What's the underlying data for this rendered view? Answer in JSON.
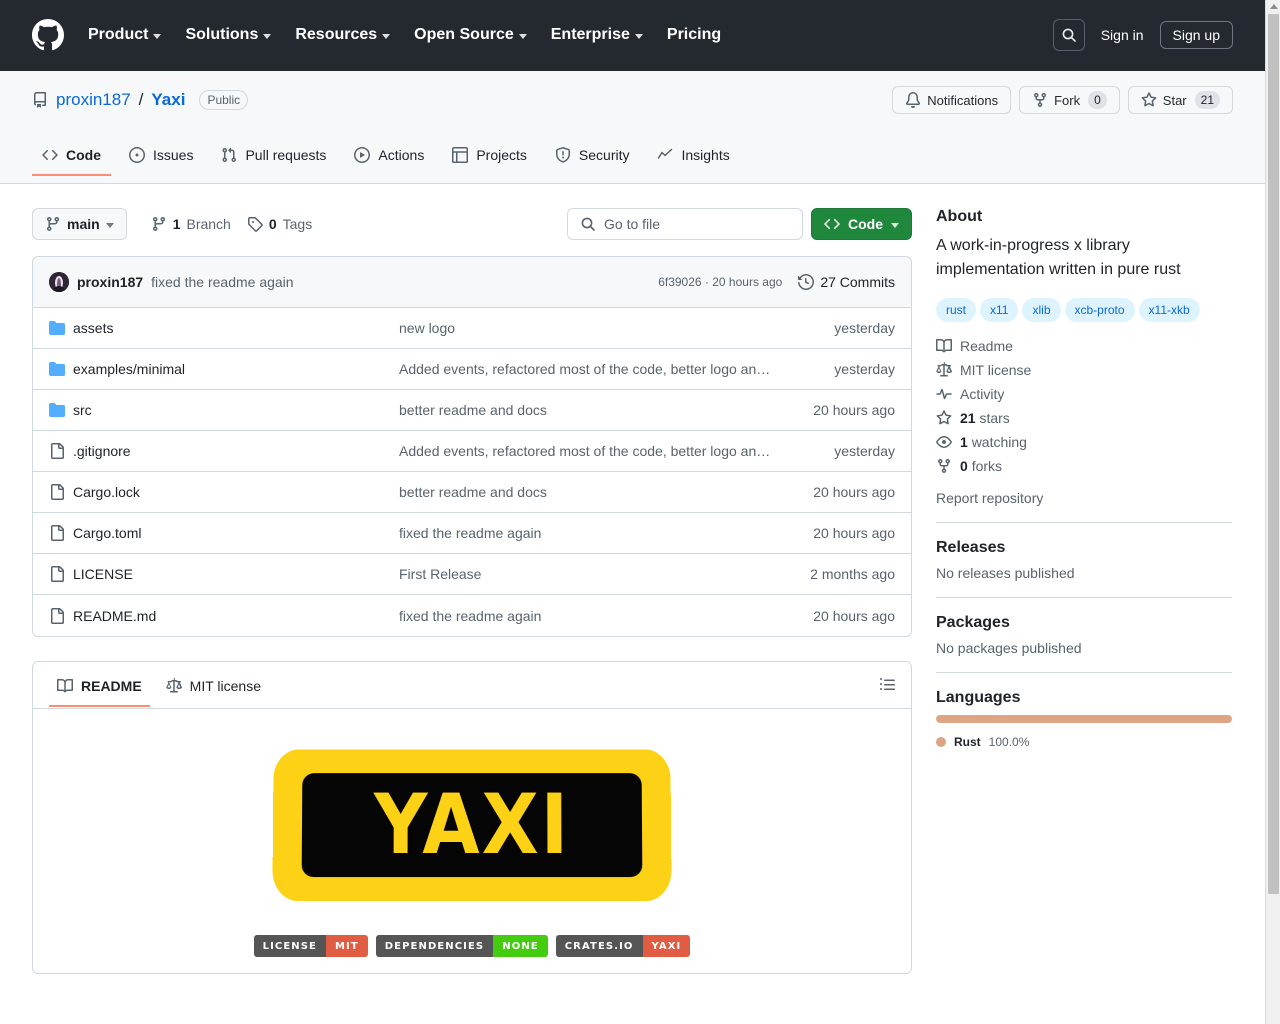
{
  "header": {
    "logo_icon": "github-mark-icon",
    "nav": [
      {
        "label": "Product",
        "has_caret": true
      },
      {
        "label": "Solutions",
        "has_caret": true
      },
      {
        "label": "Resources",
        "has_caret": true
      },
      {
        "label": "Open Source",
        "has_caret": true
      },
      {
        "label": "Enterprise",
        "has_caret": true
      },
      {
        "label": "Pricing",
        "has_caret": false
      }
    ],
    "search_icon": "search-icon",
    "sign_in": "Sign in",
    "sign_up": "Sign up"
  },
  "repo": {
    "repo_icon": "repo-icon",
    "owner": "proxin187",
    "separator": "/",
    "name": "Yaxi",
    "visibility": "Public",
    "actions": {
      "notifications": "Notifications",
      "fork_label": "Fork",
      "fork_count": "0",
      "star_label": "Star",
      "star_count": "21"
    },
    "tabs": [
      {
        "label": "Code",
        "icon": "code-icon",
        "active": true
      },
      {
        "label": "Issues",
        "icon": "issue-opened-icon",
        "active": false
      },
      {
        "label": "Pull requests",
        "icon": "git-pull-request-icon",
        "active": false
      },
      {
        "label": "Actions",
        "icon": "play-icon",
        "active": false
      },
      {
        "label": "Projects",
        "icon": "table-icon",
        "active": false
      },
      {
        "label": "Security",
        "icon": "shield-icon",
        "active": false
      },
      {
        "label": "Insights",
        "icon": "graph-icon",
        "active": false
      }
    ]
  },
  "toolbar": {
    "branch_name": "main",
    "branch_icon": "git-branch-icon",
    "branch_count": "1",
    "branch_word": "Branch",
    "tag_icon": "tag-icon",
    "tag_count": "0",
    "tag_word": "Tags",
    "search_placeholder": "Go to file",
    "code_button": "Code"
  },
  "commit_bar": {
    "avatar_name": "avatar",
    "author": "proxin187",
    "message": "fixed the readme again",
    "sha_and_time": "6f39026 · 20 hours ago",
    "commits_icon": "history-icon",
    "commits_label": "27 Commits"
  },
  "files": [
    {
      "type": "dir",
      "name": "assets",
      "message": "new logo",
      "age": "yesterday"
    },
    {
      "type": "dir",
      "name": "examples/minimal",
      "message": "Added events, refactored most of the code, better logo an…",
      "age": "yesterday"
    },
    {
      "type": "dir",
      "name": "src",
      "message": "better readme and docs",
      "age": "20 hours ago"
    },
    {
      "type": "file",
      "name": ".gitignore",
      "message": "Added events, refactored most of the code, better logo an…",
      "age": "yesterday"
    },
    {
      "type": "file",
      "name": "Cargo.lock",
      "message": "better readme and docs",
      "age": "20 hours ago"
    },
    {
      "type": "file",
      "name": "Cargo.toml",
      "message": "fixed the readme again",
      "age": "20 hours ago"
    },
    {
      "type": "file",
      "name": "LICENSE",
      "message": "First Release",
      "age": "2 months ago"
    },
    {
      "type": "file",
      "name": "README.md",
      "message": "fixed the readme again",
      "age": "20 hours ago"
    }
  ],
  "readme": {
    "tabs": [
      {
        "label": "README",
        "icon": "book-icon",
        "active": true
      },
      {
        "label": "MIT license",
        "icon": "law-icon",
        "active": false
      }
    ],
    "outline_icon": "list-unordered-icon",
    "logo_text": "YAXI",
    "logo_bg_color": "#FCD116",
    "logo_panel_color": "#050505",
    "badges": [
      {
        "key": "LICENSE",
        "value": "MIT",
        "value_color": "#e05d44"
      },
      {
        "key": "DEPENDENCIES",
        "value": "NONE",
        "value_color": "#44cc11"
      },
      {
        "key": "CRATES.IO",
        "value": "YAXI",
        "value_color": "#e05d44"
      }
    ]
  },
  "sidebar": {
    "about_title": "About",
    "description": "A work-in-progress x library implementation written in pure rust",
    "topics": [
      "rust",
      "x11",
      "xlib",
      "xcb-proto",
      "x11-xkb"
    ],
    "links": [
      {
        "icon": "book-icon",
        "label": "Readme",
        "strong": "",
        "rest": "Readme"
      },
      {
        "icon": "law-icon",
        "label": "MIT license",
        "strong": "",
        "rest": "MIT license"
      },
      {
        "icon": "pulse-icon",
        "label": "Activity",
        "strong": "",
        "rest": "Activity"
      },
      {
        "icon": "star-icon",
        "label": "21 stars",
        "strong": "21",
        "rest": "stars"
      },
      {
        "icon": "eye-icon",
        "label": "1 watching",
        "strong": "1",
        "rest": "watching"
      },
      {
        "icon": "fork-icon",
        "label": "0 forks",
        "strong": "0",
        "rest": "forks"
      }
    ],
    "report": "Report repository",
    "releases_title": "Releases",
    "releases_empty": "No releases published",
    "packages_title": "Packages",
    "packages_empty": "No packages published",
    "languages_title": "Languages",
    "languages": [
      {
        "name": "Rust",
        "percent": "100.0%",
        "color": "#dea584",
        "width": "100%"
      }
    ]
  }
}
